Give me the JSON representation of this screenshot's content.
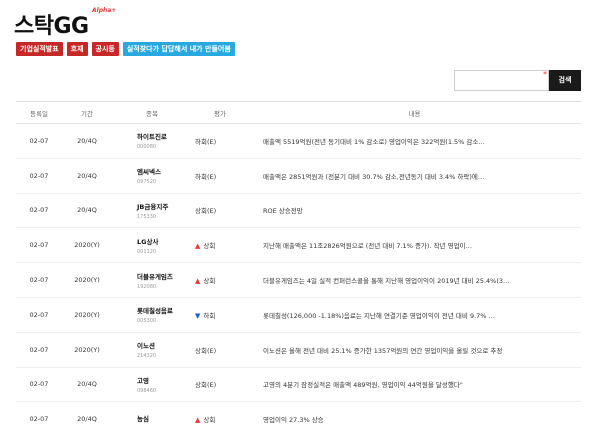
{
  "brand": {
    "logo": "스탁GG",
    "badge": "Alpha+"
  },
  "tabs": [
    {
      "label": "기업실적발표",
      "color": "#c62828"
    },
    {
      "label": "호재",
      "color": "#c62828"
    },
    {
      "label": "공시등",
      "color": "#c62828"
    },
    {
      "label": "실적찾다가 답답해서 내가 만들어봄",
      "color": "#29a8e0"
    }
  ],
  "search": {
    "placeholder": "",
    "required_mark": "*",
    "button_label": "검색"
  },
  "table": {
    "headers": {
      "date": "등록일",
      "period": "기간",
      "stock": "종목",
      "eval": "평가",
      "content": "내용"
    },
    "rows": [
      {
        "date": "02-07",
        "period": "20/4Q",
        "name": "하이트진로",
        "code": "000080",
        "arrow": "",
        "eval": "하회(E)",
        "content": "매출액 5519억원(전년 동기대비 1% 감소로) 영업이익은 322억원(1.5% 감소…"
      },
      {
        "date": "02-07",
        "period": "20/4Q",
        "name": "엠씨넥스",
        "code": "097520",
        "arrow": "",
        "eval": "하회(E)",
        "content": "매출액은 2851억원과 (전분기 대비 30.7% 감소,전년동기 대비 3.4% 하락)에…"
      },
      {
        "date": "02-07",
        "period": "20/4Q",
        "name": "JB금융지주",
        "code": "175330",
        "arrow": "",
        "eval": "상회(E)",
        "content": "ROE 상승전망"
      },
      {
        "date": "02-07",
        "period": "2020(Y)",
        "name": "LG상사",
        "code": "001120",
        "arrow": "up",
        "eval": "상회",
        "content": "지난해 매출액은 11조2826억원으로 (전년 대비 7.1% 증가). 작년 영업이…"
      },
      {
        "date": "02-07",
        "period": "2020(Y)",
        "name": "더블유게임즈",
        "code": "192080",
        "arrow": "up",
        "eval": "상회",
        "content": "더블유게임즈는 4일 실적 컨퍼런스콜을 통해 지난해 영업이익이 2019년 대비 25.4%(3…"
      },
      {
        "date": "02-07",
        "period": "2020(Y)",
        "name": "롯데칠성음료",
        "code": "005300",
        "arrow": "down",
        "eval": "하회",
        "content": "롯데칠성(126,000 -1.18%)음료는 지난해 연결기준 영업이익이 전년 대비 9.7% …"
      },
      {
        "date": "02-07",
        "period": "2020(Y)",
        "name": "이노션",
        "code": "214320",
        "arrow": "",
        "eval": "상회(E)",
        "content": "이노션은 올해 전년 대비 25.1% 증가한 1357억원의 연간 영업이익을 올릴 것으로 추정"
      },
      {
        "date": "02-07",
        "period": "20/4Q",
        "name": "고영",
        "code": "098460",
        "arrow": "",
        "eval": "상회(E)",
        "content": "고영의 4분기 잠정실적은 매출액 489억원, 영업이익 44억원을 달성했다\""
      },
      {
        "date": "02-07",
        "period": "20/4Q",
        "name": "농심",
        "code": "",
        "arrow": "up",
        "eval": "상회",
        "content": "영업이익 27.3% 상승"
      }
    ]
  },
  "colors": {
    "up": "#e53935",
    "down": "#1e5fd8",
    "tab_red": "#c62828",
    "tab_blue": "#29a8e0"
  },
  "icons": {
    "up": "triangle-up-icon",
    "down": "triangle-down-icon"
  }
}
